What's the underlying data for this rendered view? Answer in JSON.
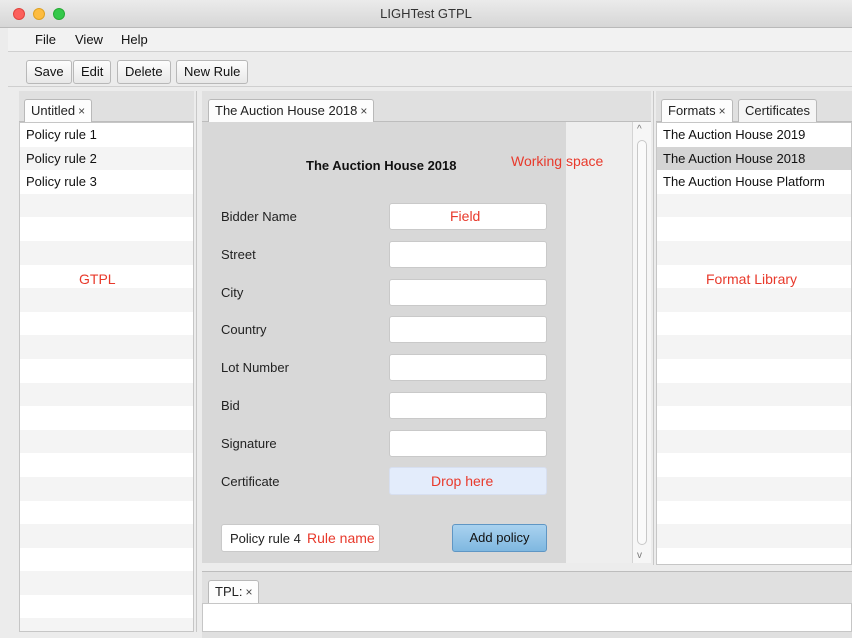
{
  "window": {
    "title": "LIGHTest GTPL"
  },
  "menu": {
    "file": "File",
    "view": "View",
    "help": "Help"
  },
  "toolbar": {
    "save": "Save",
    "edit": "Edit",
    "delete": "Delete",
    "new_rule": "New Rule"
  },
  "left": {
    "tab": "Untitled",
    "close": "×",
    "items": [
      "Policy rule 1",
      "Policy rule 2",
      "Policy rule 3"
    ],
    "annotation": "GTPL"
  },
  "center": {
    "tab": "The Auction House 2018",
    "close": "×",
    "annotation_workspace": "Working space",
    "annotation_field": "Field",
    "annotation_drop": "Drop here",
    "annotation_rule": "Rule name",
    "form": {
      "title": "The Auction House 2018",
      "fields": [
        "Bidder Name",
        "Street",
        "City",
        "Country",
        "Lot Number",
        "Bid",
        "Signature",
        "Certificate"
      ]
    },
    "rule_name_value": "Policy rule 4",
    "add_policy": "Add policy"
  },
  "right": {
    "tab_formats": "Formats",
    "tab_certificates": "Certificates",
    "close": "×",
    "items": [
      "The Auction House 2019",
      "The Auction House 2018",
      "The Auction House Platform"
    ],
    "annotation": "Format Library"
  },
  "bottom": {
    "tab": "TPL:",
    "close": "×"
  },
  "scroll": {
    "up": "^",
    "down": "v"
  }
}
